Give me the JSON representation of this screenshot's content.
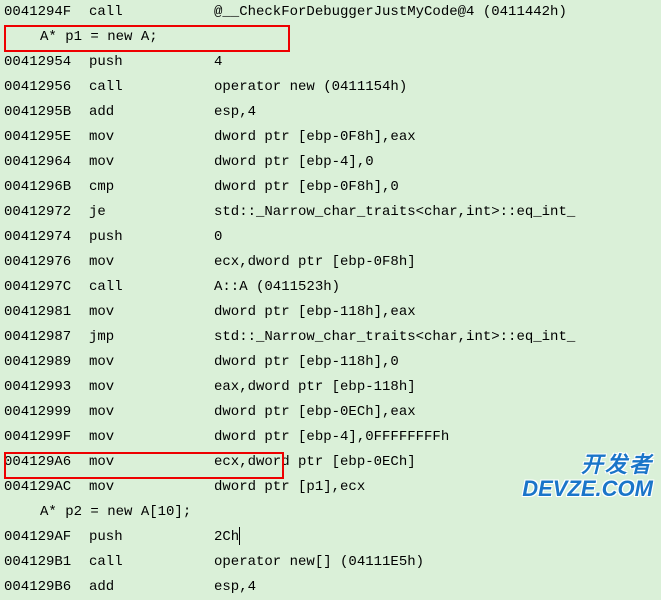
{
  "rows": [
    {
      "type": "asm",
      "addr": "0041294F",
      "instr": "call",
      "operand": "@__CheckForDebuggerJustMyCode@4 (0411442h)"
    },
    {
      "type": "src",
      "text": "A* p1 = new A;"
    },
    {
      "type": "asm",
      "addr": "00412954",
      "instr": "push",
      "operand": "4"
    },
    {
      "type": "asm",
      "addr": "00412956",
      "instr": "call",
      "operand": "operator new (0411154h)"
    },
    {
      "type": "asm",
      "addr": "0041295B",
      "instr": "add",
      "operand": "esp,4"
    },
    {
      "type": "asm",
      "addr": "0041295E",
      "instr": "mov",
      "operand": "dword ptr [ebp-0F8h],eax"
    },
    {
      "type": "asm",
      "addr": "00412964",
      "instr": "mov",
      "operand": "dword ptr [ebp-4],0"
    },
    {
      "type": "asm",
      "addr": "0041296B",
      "instr": "cmp",
      "operand": "dword ptr [ebp-0F8h],0"
    },
    {
      "type": "asm",
      "addr": "00412972",
      "instr": "je",
      "operand": "std::_Narrow_char_traits<char,int>::eq_int_"
    },
    {
      "type": "asm",
      "addr": "00412974",
      "instr": "push",
      "operand": "0"
    },
    {
      "type": "asm",
      "addr": "00412976",
      "instr": "mov",
      "operand": "ecx,dword ptr [ebp-0F8h]"
    },
    {
      "type": "asm",
      "addr": "0041297C",
      "instr": "call",
      "operand": "A::A (0411523h)"
    },
    {
      "type": "asm",
      "addr": "00412981",
      "instr": "mov",
      "operand": "dword ptr [ebp-118h],eax"
    },
    {
      "type": "asm",
      "addr": "00412987",
      "instr": "jmp",
      "operand": "std::_Narrow_char_traits<char,int>::eq_int_"
    },
    {
      "type": "asm",
      "addr": "00412989",
      "instr": "mov",
      "operand": "dword ptr [ebp-118h],0"
    },
    {
      "type": "asm",
      "addr": "00412993",
      "instr": "mov",
      "operand": "eax,dword ptr [ebp-118h]"
    },
    {
      "type": "asm",
      "addr": "00412999",
      "instr": "mov",
      "operand": "dword ptr [ebp-0ECh],eax"
    },
    {
      "type": "asm",
      "addr": "0041299F",
      "instr": "mov",
      "operand": "dword ptr [ebp-4],0FFFFFFFFh"
    },
    {
      "type": "asm",
      "addr": "004129A6",
      "instr": "mov",
      "operand": "ecx,dword ptr [ebp-0ECh]"
    },
    {
      "type": "asm",
      "addr": "004129AC",
      "instr": "mov",
      "operand": "dword ptr [p1],ecx"
    },
    {
      "type": "src",
      "text": "A* p2 = new A[10];"
    },
    {
      "type": "asm",
      "addr": "004129AF",
      "instr": "push",
      "operand": "2Ch",
      "cursor": true
    },
    {
      "type": "asm",
      "addr": "004129B1",
      "instr": "call",
      "operand": "operator new[] (04111E5h)"
    },
    {
      "type": "asm",
      "addr": "004129B6",
      "instr": "add",
      "operand": "esp,4"
    }
  ],
  "watermark": {
    "line1": "开发者",
    "line2": "DEVZE.COM"
  }
}
